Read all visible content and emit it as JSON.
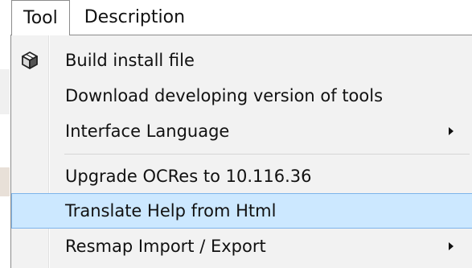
{
  "menubar": {
    "tabs": [
      {
        "label": "Tool"
      },
      {
        "label": "Description"
      }
    ]
  },
  "dropdown": {
    "items": [
      {
        "label": "Build install file",
        "icon": "package-box-icon",
        "submenu": false
      },
      {
        "label": "Download developing version of tools",
        "submenu": false
      },
      {
        "label": "Interface Language",
        "submenu": true
      },
      {
        "label": "Upgrade OCRes to 10.116.36",
        "submenu": false
      },
      {
        "label": "Translate Help from Html",
        "submenu": false,
        "highlighted": true
      },
      {
        "label": "Resmap Import / Export",
        "submenu": true
      }
    ]
  },
  "colors": {
    "menu_background": "#f2f2f2",
    "highlight_fill": "#cce8ff",
    "highlight_border": "#7eb4ea",
    "menu_border": "#8c8c8c"
  }
}
